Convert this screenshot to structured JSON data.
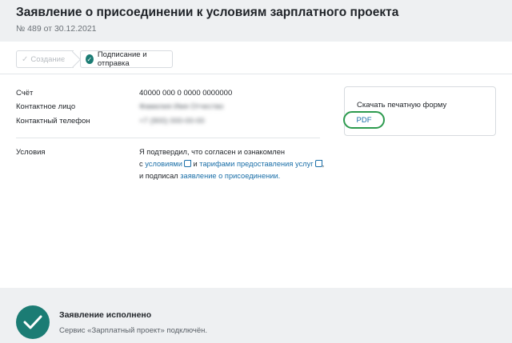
{
  "header": {
    "title": "Заявление о присоединении к условиям зарплатного проекта",
    "subtitle": "№ 489 от 30.12.2021"
  },
  "steps": [
    {
      "label": "Создание",
      "state": "done"
    },
    {
      "label": "Подписание и отправка",
      "state": "active"
    }
  ],
  "fields": {
    "account_label": "Счёт",
    "account_value": "40000 000 0 0000 0000000",
    "contact_label": "Контактное лицо",
    "contact_value": "Фамилия Имя Отчество",
    "phone_label": "Контактный телефон",
    "phone_value": "+7 (900) 000-00-00"
  },
  "terms": {
    "label": "Условия",
    "line1": "Я подтвердил, что согласен и ознакомлен",
    "prefix": "с",
    "link_conditions": "условиями",
    "and": "и",
    "link_tariffs": "тарифами предоставления услуг",
    "comma": ",",
    "signed": "и подписал",
    "link_statement": "заявление о присоединении."
  },
  "download": {
    "label": "Скачать печатную форму",
    "pdf_button": "PDF"
  },
  "status": {
    "title": "Заявление исполнено",
    "description": "Сервис «Зарплатный проект» подключён."
  },
  "colors": {
    "accent": "#1b7c74",
    "link": "#1b6fa8",
    "pdf_border": "#2c9a4e"
  }
}
